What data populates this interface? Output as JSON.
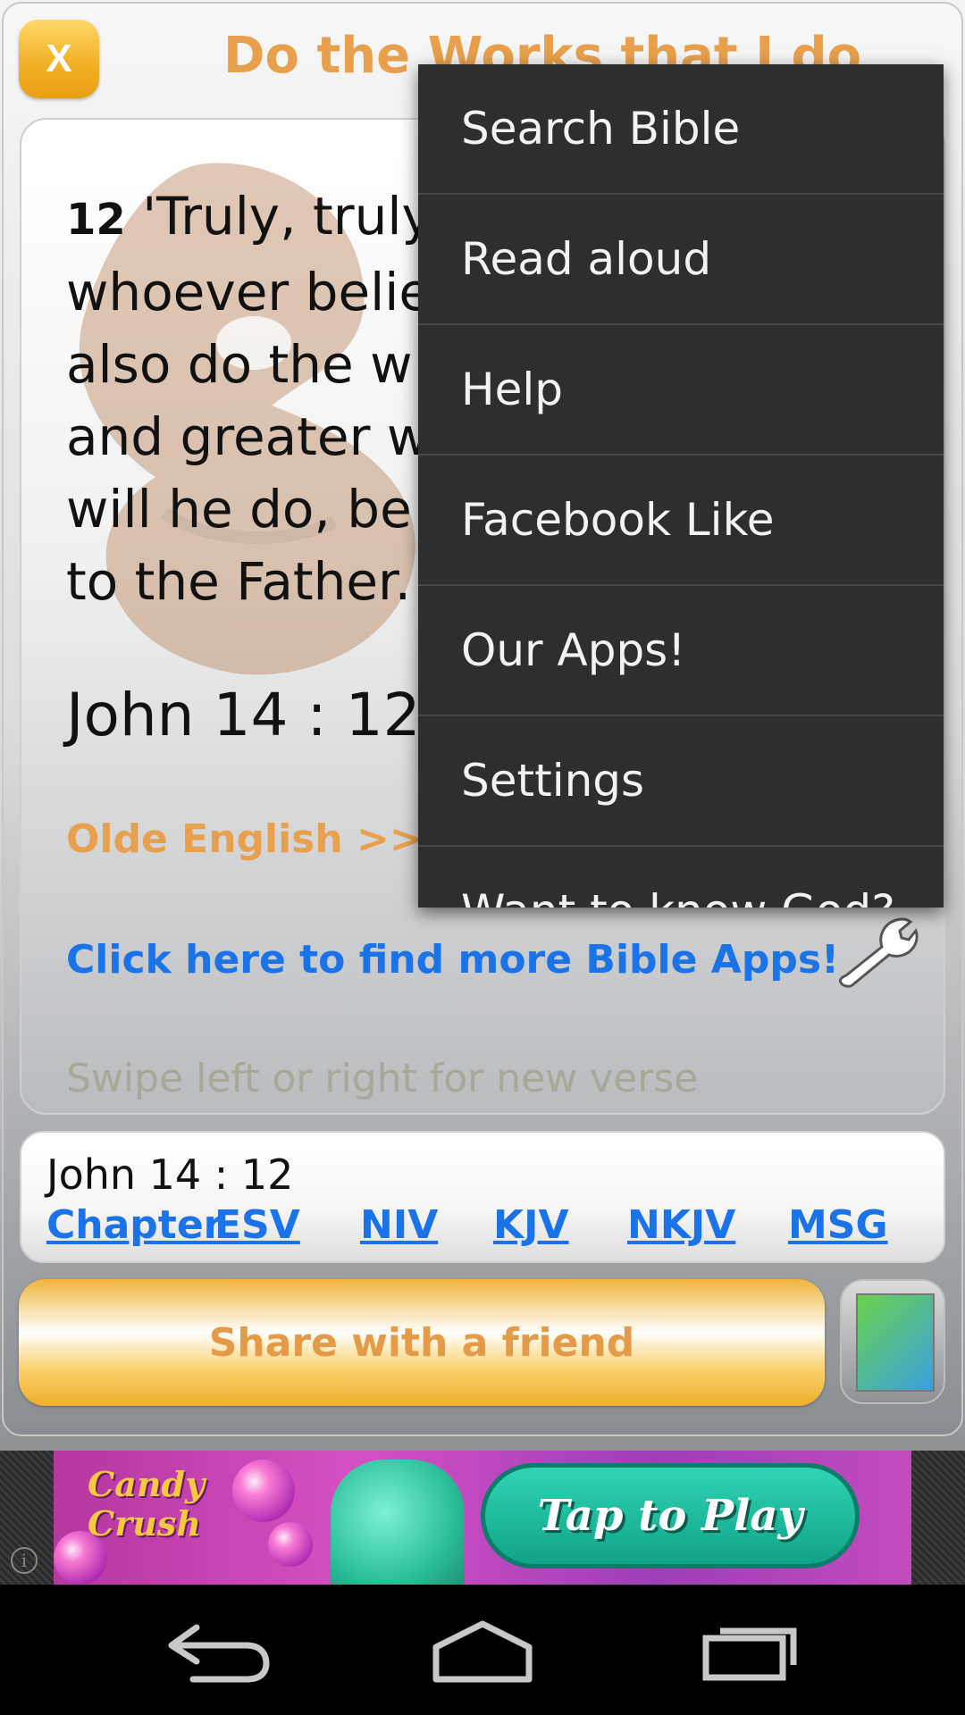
{
  "header": {
    "close_label": "X",
    "title": "Do the Works that I do"
  },
  "verse": {
    "number": "12",
    "lines": [
      "'Truly, truly",
      "whoever belie",
      "also do the w",
      "and greater w",
      "will he do, be",
      "to the Father."
    ],
    "reference": "John 14 : 12"
  },
  "links": {
    "olde_english": "Olde English >>",
    "more_apps": "Click here to find more Bible Apps!"
  },
  "hint": "Swipe left or right for new verse",
  "ref_bar": {
    "label": "John 14 : 12",
    "links": [
      "Chapter",
      "ESV",
      "NIV",
      "KJV",
      "NKJV",
      "MSG"
    ]
  },
  "share_button": "Share with a friend",
  "ad": {
    "brand_line1": "Candy",
    "brand_line2": "Crush",
    "cta": "Tap to Play",
    "info": "i"
  },
  "menu": {
    "items": [
      "Search Bible",
      "Read aloud",
      "Help",
      "Facebook Like",
      "Our Apps!",
      "Settings",
      "Want to know God?"
    ]
  },
  "icons": {
    "close": "close-icon",
    "wrench": "wrench-icon",
    "app": "app-icon",
    "back": "back-icon",
    "home": "home-icon",
    "recents": "recent-apps-icon",
    "info": "info-icon"
  },
  "colors": {
    "accent_orange": "#e8a04c",
    "link_blue": "#1a73e8",
    "menu_bg": "#2e2e2e",
    "button_gold": "#f2b127"
  }
}
